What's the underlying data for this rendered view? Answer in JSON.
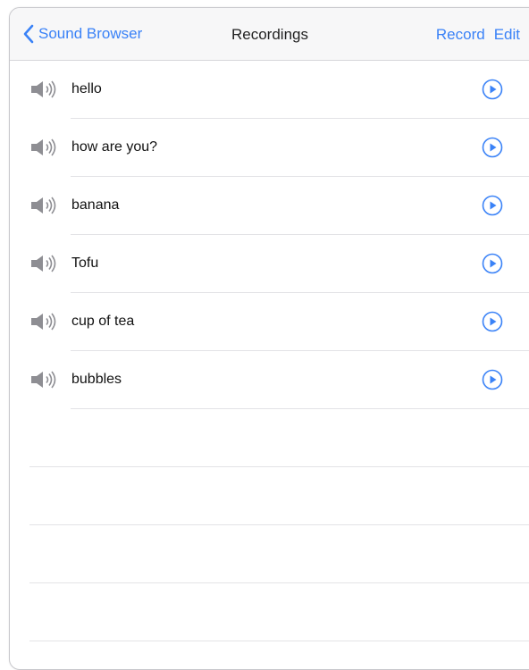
{
  "navbar": {
    "back_label": "Sound Browser",
    "title": "Recordings",
    "record_label": "Record",
    "edit_label": "Edit"
  },
  "recordings": [
    {
      "label": "hello"
    },
    {
      "label": "how are you?"
    },
    {
      "label": "banana"
    },
    {
      "label": "Tofu"
    },
    {
      "label": "cup of tea"
    },
    {
      "label": "bubbles"
    }
  ],
  "icons": {
    "back": "chevron-left-icon",
    "speaker": "speaker-icon",
    "play": "play-circle-icon"
  },
  "colors": {
    "accent": "#3a82f7",
    "navbar_bg": "#f7f7f8",
    "separator": "#e3e3e6",
    "speaker_gray": "#8e8e93"
  }
}
